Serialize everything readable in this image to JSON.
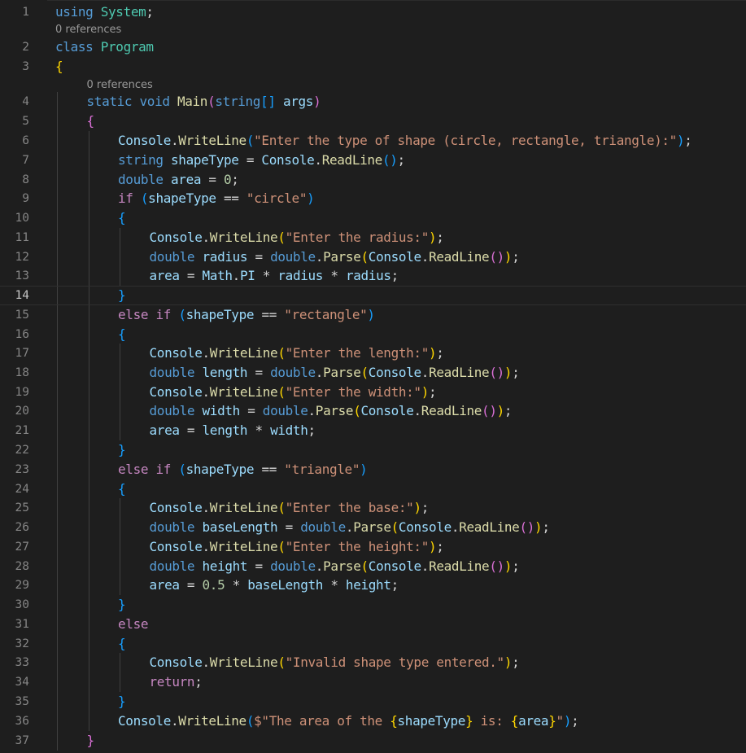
{
  "editor": {
    "language": "csharp",
    "theme_colors": {
      "background": "#1e1e1e",
      "line_number": "#858585",
      "keyword": "#569cd6",
      "control": "#c586c0",
      "type": "#4ec9b0",
      "function": "#dcdcaa",
      "variable": "#9cdcfe",
      "string": "#ce9178",
      "number": "#b5cea8",
      "bracket_1": "#ffd700",
      "bracket_2": "#da70d6",
      "bracket_3": "#179fff"
    },
    "current_line": 14,
    "code_lens": [
      {
        "text": "0 references",
        "above_line": 2
      },
      {
        "text": "0 references",
        "above_line": 4
      }
    ],
    "lines": [
      {
        "n": "1",
        "indent": 0,
        "tokens": [
          [
            "kw",
            "using"
          ],
          [
            "pl",
            " "
          ],
          [
            "ty",
            "System"
          ],
          [
            "pl",
            ";"
          ]
        ]
      },
      {
        "n": "2",
        "indent": 0,
        "tokens": [
          [
            "kw",
            "class"
          ],
          [
            "pl",
            " "
          ],
          [
            "ty",
            "Program"
          ]
        ]
      },
      {
        "n": "3",
        "indent": 0,
        "tokens": [
          [
            "b1",
            "{"
          ]
        ]
      },
      {
        "n": "4",
        "indent": 1,
        "tokens": [
          [
            "kw",
            "static"
          ],
          [
            "pl",
            " "
          ],
          [
            "kw",
            "void"
          ],
          [
            "pl",
            " "
          ],
          [
            "fn",
            "Main"
          ],
          [
            "b2",
            "("
          ],
          [
            "kw",
            "string"
          ],
          [
            "b3",
            "[]"
          ],
          [
            "pl",
            " "
          ],
          [
            "vr",
            "args"
          ],
          [
            "b2",
            ")"
          ]
        ]
      },
      {
        "n": "5",
        "indent": 1,
        "tokens": [
          [
            "b2",
            "{"
          ]
        ]
      },
      {
        "n": "6",
        "indent": 2,
        "tokens": [
          [
            "vr",
            "Console"
          ],
          [
            "pl",
            "."
          ],
          [
            "fn",
            "WriteLine"
          ],
          [
            "b3",
            "("
          ],
          [
            "str",
            "\"Enter the type of shape (circle, rectangle, triangle):\""
          ],
          [
            "b3",
            ")"
          ],
          [
            "pl",
            ";"
          ]
        ]
      },
      {
        "n": "7",
        "indent": 2,
        "tokens": [
          [
            "kw",
            "string"
          ],
          [
            "pl",
            " "
          ],
          [
            "vr",
            "shapeType"
          ],
          [
            "pl",
            " = "
          ],
          [
            "vr",
            "Console"
          ],
          [
            "pl",
            "."
          ],
          [
            "fn",
            "ReadLine"
          ],
          [
            "b3",
            "()"
          ],
          [
            "pl",
            ";"
          ]
        ]
      },
      {
        "n": "8",
        "indent": 2,
        "tokens": [
          [
            "kw",
            "double"
          ],
          [
            "pl",
            " "
          ],
          [
            "vr",
            "area"
          ],
          [
            "pl",
            " = "
          ],
          [
            "num",
            "0"
          ],
          [
            "pl",
            ";"
          ]
        ]
      },
      {
        "n": "9",
        "indent": 2,
        "tokens": [
          [
            "ctl",
            "if"
          ],
          [
            "pl",
            " "
          ],
          [
            "b3",
            "("
          ],
          [
            "vr",
            "shapeType"
          ],
          [
            "pl",
            " == "
          ],
          [
            "str",
            "\"circle\""
          ],
          [
            "b3",
            ")"
          ]
        ]
      },
      {
        "n": "10",
        "indent": 2,
        "tokens": [
          [
            "b3",
            "{"
          ]
        ]
      },
      {
        "n": "11",
        "indent": 3,
        "tokens": [
          [
            "vr",
            "Console"
          ],
          [
            "pl",
            "."
          ],
          [
            "fn",
            "WriteLine"
          ],
          [
            "b1",
            "("
          ],
          [
            "str",
            "\"Enter the radius:\""
          ],
          [
            "b1",
            ")"
          ],
          [
            "pl",
            ";"
          ]
        ]
      },
      {
        "n": "12",
        "indent": 3,
        "tokens": [
          [
            "kw",
            "double"
          ],
          [
            "pl",
            " "
          ],
          [
            "vr",
            "radius"
          ],
          [
            "pl",
            " = "
          ],
          [
            "kw",
            "double"
          ],
          [
            "pl",
            "."
          ],
          [
            "fn",
            "Parse"
          ],
          [
            "b1",
            "("
          ],
          [
            "vr",
            "Console"
          ],
          [
            "pl",
            "."
          ],
          [
            "fn",
            "ReadLine"
          ],
          [
            "b2",
            "()"
          ],
          [
            "b1",
            ")"
          ],
          [
            "pl",
            ";"
          ]
        ]
      },
      {
        "n": "13",
        "indent": 3,
        "tokens": [
          [
            "vr",
            "area"
          ],
          [
            "pl",
            " = "
          ],
          [
            "vr",
            "Math"
          ],
          [
            "pl",
            "."
          ],
          [
            "vr",
            "PI"
          ],
          [
            "pl",
            " * "
          ],
          [
            "vr",
            "radius"
          ],
          [
            "pl",
            " * "
          ],
          [
            "vr",
            "radius"
          ],
          [
            "pl",
            ";"
          ]
        ]
      },
      {
        "n": "14",
        "indent": 2,
        "tokens": [
          [
            "b3",
            "}"
          ]
        ]
      },
      {
        "n": "15",
        "indent": 2,
        "tokens": [
          [
            "ctl",
            "else"
          ],
          [
            "pl",
            " "
          ],
          [
            "ctl",
            "if"
          ],
          [
            "pl",
            " "
          ],
          [
            "b3",
            "("
          ],
          [
            "vr",
            "shapeType"
          ],
          [
            "pl",
            " == "
          ],
          [
            "str",
            "\"rectangle\""
          ],
          [
            "b3",
            ")"
          ]
        ]
      },
      {
        "n": "16",
        "indent": 2,
        "tokens": [
          [
            "b3",
            "{"
          ]
        ]
      },
      {
        "n": "17",
        "indent": 3,
        "tokens": [
          [
            "vr",
            "Console"
          ],
          [
            "pl",
            "."
          ],
          [
            "fn",
            "WriteLine"
          ],
          [
            "b1",
            "("
          ],
          [
            "str",
            "\"Enter the length:\""
          ],
          [
            "b1",
            ")"
          ],
          [
            "pl",
            ";"
          ]
        ]
      },
      {
        "n": "18",
        "indent": 3,
        "tokens": [
          [
            "kw",
            "double"
          ],
          [
            "pl",
            " "
          ],
          [
            "vr",
            "length"
          ],
          [
            "pl",
            " = "
          ],
          [
            "kw",
            "double"
          ],
          [
            "pl",
            "."
          ],
          [
            "fn",
            "Parse"
          ],
          [
            "b1",
            "("
          ],
          [
            "vr",
            "Console"
          ],
          [
            "pl",
            "."
          ],
          [
            "fn",
            "ReadLine"
          ],
          [
            "b2",
            "()"
          ],
          [
            "b1",
            ")"
          ],
          [
            "pl",
            ";"
          ]
        ]
      },
      {
        "n": "19",
        "indent": 3,
        "tokens": [
          [
            "vr",
            "Console"
          ],
          [
            "pl",
            "."
          ],
          [
            "fn",
            "WriteLine"
          ],
          [
            "b1",
            "("
          ],
          [
            "str",
            "\"Enter the width:\""
          ],
          [
            "b1",
            ")"
          ],
          [
            "pl",
            ";"
          ]
        ]
      },
      {
        "n": "20",
        "indent": 3,
        "tokens": [
          [
            "kw",
            "double"
          ],
          [
            "pl",
            " "
          ],
          [
            "vr",
            "width"
          ],
          [
            "pl",
            " = "
          ],
          [
            "kw",
            "double"
          ],
          [
            "pl",
            "."
          ],
          [
            "fn",
            "Parse"
          ],
          [
            "b1",
            "("
          ],
          [
            "vr",
            "Console"
          ],
          [
            "pl",
            "."
          ],
          [
            "fn",
            "ReadLine"
          ],
          [
            "b2",
            "()"
          ],
          [
            "b1",
            ")"
          ],
          [
            "pl",
            ";"
          ]
        ]
      },
      {
        "n": "21",
        "indent": 3,
        "tokens": [
          [
            "vr",
            "area"
          ],
          [
            "pl",
            " = "
          ],
          [
            "vr",
            "length"
          ],
          [
            "pl",
            " * "
          ],
          [
            "vr",
            "width"
          ],
          [
            "pl",
            ";"
          ]
        ]
      },
      {
        "n": "22",
        "indent": 2,
        "tokens": [
          [
            "b3",
            "}"
          ]
        ]
      },
      {
        "n": "23",
        "indent": 2,
        "tokens": [
          [
            "ctl",
            "else"
          ],
          [
            "pl",
            " "
          ],
          [
            "ctl",
            "if"
          ],
          [
            "pl",
            " "
          ],
          [
            "b3",
            "("
          ],
          [
            "vr",
            "shapeType"
          ],
          [
            "pl",
            " == "
          ],
          [
            "str",
            "\"triangle\""
          ],
          [
            "b3",
            ")"
          ]
        ]
      },
      {
        "n": "24",
        "indent": 2,
        "tokens": [
          [
            "b3",
            "{"
          ]
        ]
      },
      {
        "n": "25",
        "indent": 3,
        "tokens": [
          [
            "vr",
            "Console"
          ],
          [
            "pl",
            "."
          ],
          [
            "fn",
            "WriteLine"
          ],
          [
            "b1",
            "("
          ],
          [
            "str",
            "\"Enter the base:\""
          ],
          [
            "b1",
            ")"
          ],
          [
            "pl",
            ";"
          ]
        ]
      },
      {
        "n": "26",
        "indent": 3,
        "tokens": [
          [
            "kw",
            "double"
          ],
          [
            "pl",
            " "
          ],
          [
            "vr",
            "baseLength"
          ],
          [
            "pl",
            " = "
          ],
          [
            "kw",
            "double"
          ],
          [
            "pl",
            "."
          ],
          [
            "fn",
            "Parse"
          ],
          [
            "b1",
            "("
          ],
          [
            "vr",
            "Console"
          ],
          [
            "pl",
            "."
          ],
          [
            "fn",
            "ReadLine"
          ],
          [
            "b2",
            "()"
          ],
          [
            "b1",
            ")"
          ],
          [
            "pl",
            ";"
          ]
        ]
      },
      {
        "n": "27",
        "indent": 3,
        "tokens": [
          [
            "vr",
            "Console"
          ],
          [
            "pl",
            "."
          ],
          [
            "fn",
            "WriteLine"
          ],
          [
            "b1",
            "("
          ],
          [
            "str",
            "\"Enter the height:\""
          ],
          [
            "b1",
            ")"
          ],
          [
            "pl",
            ";"
          ]
        ]
      },
      {
        "n": "28",
        "indent": 3,
        "tokens": [
          [
            "kw",
            "double"
          ],
          [
            "pl",
            " "
          ],
          [
            "vr",
            "height"
          ],
          [
            "pl",
            " = "
          ],
          [
            "kw",
            "double"
          ],
          [
            "pl",
            "."
          ],
          [
            "fn",
            "Parse"
          ],
          [
            "b1",
            "("
          ],
          [
            "vr",
            "Console"
          ],
          [
            "pl",
            "."
          ],
          [
            "fn",
            "ReadLine"
          ],
          [
            "b2",
            "()"
          ],
          [
            "b1",
            ")"
          ],
          [
            "pl",
            ";"
          ]
        ]
      },
      {
        "n": "29",
        "indent": 3,
        "tokens": [
          [
            "vr",
            "area"
          ],
          [
            "pl",
            " = "
          ],
          [
            "num",
            "0.5"
          ],
          [
            "pl",
            " * "
          ],
          [
            "vr",
            "baseLength"
          ],
          [
            "pl",
            " * "
          ],
          [
            "vr",
            "height"
          ],
          [
            "pl",
            ";"
          ]
        ]
      },
      {
        "n": "30",
        "indent": 2,
        "tokens": [
          [
            "b3",
            "}"
          ]
        ]
      },
      {
        "n": "31",
        "indent": 2,
        "tokens": [
          [
            "ctl",
            "else"
          ]
        ]
      },
      {
        "n": "32",
        "indent": 2,
        "tokens": [
          [
            "b3",
            "{"
          ]
        ]
      },
      {
        "n": "33",
        "indent": 3,
        "tokens": [
          [
            "vr",
            "Console"
          ],
          [
            "pl",
            "."
          ],
          [
            "fn",
            "WriteLine"
          ],
          [
            "b1",
            "("
          ],
          [
            "str",
            "\"Invalid shape type entered.\""
          ],
          [
            "b1",
            ")"
          ],
          [
            "pl",
            ";"
          ]
        ]
      },
      {
        "n": "34",
        "indent": 3,
        "tokens": [
          [
            "ctl",
            "return"
          ],
          [
            "pl",
            ";"
          ]
        ]
      },
      {
        "n": "35",
        "indent": 2,
        "tokens": [
          [
            "b3",
            "}"
          ]
        ]
      },
      {
        "n": "36",
        "indent": 2,
        "tokens": [
          [
            "vr",
            "Console"
          ],
          [
            "pl",
            "."
          ],
          [
            "fn",
            "WriteLine"
          ],
          [
            "b3",
            "("
          ],
          [
            "str",
            "$\"The area of the "
          ],
          [
            "b1",
            "{"
          ],
          [
            "vr",
            "shapeType"
          ],
          [
            "b1",
            "}"
          ],
          [
            "str",
            " is: "
          ],
          [
            "b1",
            "{"
          ],
          [
            "vr",
            "area"
          ],
          [
            "b1",
            "}"
          ],
          [
            "str",
            "\""
          ],
          [
            "b3",
            ")"
          ],
          [
            "pl",
            ";"
          ]
        ]
      },
      {
        "n": "37",
        "indent": 1,
        "tokens": [
          [
            "b2",
            "}"
          ]
        ]
      }
    ]
  }
}
